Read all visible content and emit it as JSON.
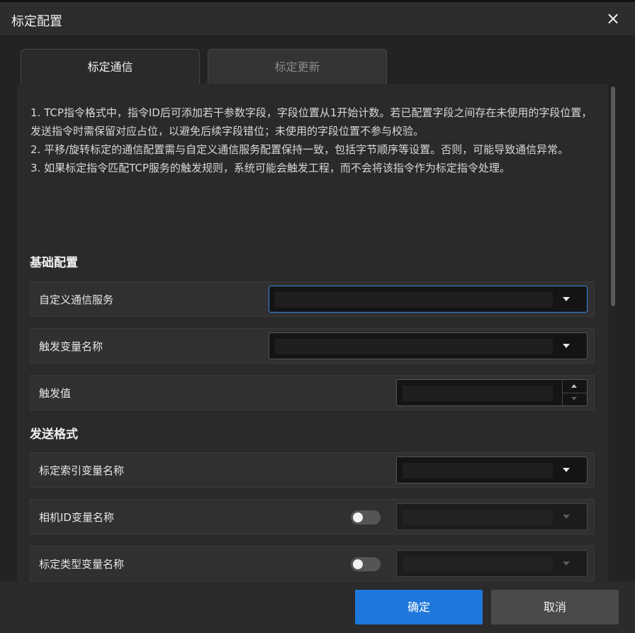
{
  "dialog": {
    "title": "标定配置",
    "close_icon": "×"
  },
  "tabs": [
    {
      "label": "标定通信",
      "active": true
    },
    {
      "label": "标定更新",
      "active": false
    }
  ],
  "notes": [
    "1. TCP指令格式中，指令ID后可添加若干参数字段，字段位置从1开始计数。若已配置字段之间存在未使用的字段位置，发送指令时需保留对应占位，以避免后续字段错位；未使用的字段位置不参与校验。",
    "2. 平移/旋转标定的通信配置需与自定义通信服务配置保持一致，包括字节顺序等设置。否则，可能导致通信异常。",
    "3. 如果标定指令匹配TCP服务的触发规则，系统可能会触发工程，而不会将该指令作为标定指令处理。"
  ],
  "basic_config": {
    "title": "基础配置",
    "custom_comm_service": {
      "label": "自定义通信服务",
      "value": ""
    },
    "trigger_var_name": {
      "label": "触发变量名称",
      "value": ""
    },
    "trigger_value": {
      "label": "触发值",
      "value": ""
    }
  },
  "send_format": {
    "title": "发送格式",
    "calib_index_var": {
      "label": "标定索引变量名称",
      "value": ""
    },
    "camera_id_var": {
      "label": "相机ID变量名称",
      "enabled": false,
      "value": ""
    },
    "calib_type_var": {
      "label": "标定类型变量名称",
      "enabled": false,
      "value": ""
    }
  },
  "footer": {
    "ok_label": "确定",
    "cancel_label": "取消"
  },
  "colors": {
    "accent": "#1e78dc",
    "focus_border": "#3a88e8",
    "background": "#2b2b2b"
  }
}
